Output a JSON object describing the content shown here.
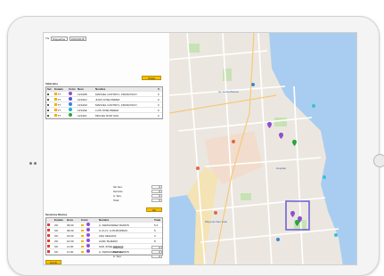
{
  "toolbar": {
    "label": "TG",
    "period": "Dispatcher",
    "date": "19/03/2018"
  },
  "vehicles": {
    "title": "Vehiculos",
    "button": "Todos",
    "columns": [
      "Sel",
      "Estado",
      "Color",
      "Num",
      "Nombre",
      "V"
    ],
    "rows": [
      {
        "sel": "☑",
        "estado": "TT",
        "status": "#f2b200",
        "pin": "#8f4fd1",
        "num": "1234AB",
        "nombre": "MANUEL CASTRO L FRANCISCO",
        "v": "0"
      },
      {
        "sel": "☑",
        "estado": "TT",
        "status": "#f2b200",
        "pin": "#5c4fd6",
        "num": "1234AC",
        "nombre": "JUAN JOSE PEREZ",
        "v": "0"
      },
      {
        "sel": "☑",
        "estado": "TT",
        "status": "#f2b200",
        "pin": "#3d7ee0",
        "num": "1234AD",
        "nombre": "MANUEL CASTRO L FRANCISCO",
        "v": "0"
      },
      {
        "sel": "☑",
        "estado": "TT",
        "status": "#f2b200",
        "pin": "#1fb3c0",
        "num": "1234AE",
        "nombre": "LUIS JOSE PEREZ",
        "v": "0"
      },
      {
        "sel": "☑",
        "estado": "TT",
        "status": "#f2b200",
        "pin": "#27a83c",
        "num": "1234AF",
        "nombre": "MIGUEL RUIZ SAS",
        "v": "0"
      }
    ]
  },
  "summary_top": {
    "rows": [
      {
        "label": "Sin Ser.",
        "value": "0"
      },
      {
        "label": "Servicio",
        "value": "0"
      },
      {
        "label": "A. Ses.",
        "value": "0"
      },
      {
        "label": "Total",
        "value": "5"
      }
    ],
    "button": "Ver"
  },
  "services": {
    "title": "Servicios Diarios",
    "columns": [
      "",
      "Estado",
      "Hora",
      "Color",
      "Nombre",
      "Total"
    ],
    "rows": [
      {
        "status": "#e23a2e",
        "estado": "OK",
        "hora": "09:00",
        "sq": "#f2b200",
        "pin": "#8f4fd1",
        "nombre": "A. FERNANDEZ RAMOS",
        "total": "5.4"
      },
      {
        "status": "#e23a2e",
        "estado": "OK",
        "hora": "09:30",
        "sq": "#f2b200",
        "pin": "#8f4fd1",
        "nombre": "A.V.H.V. LUIS BORRAS",
        "total": "5"
      },
      {
        "status": "#e23a2e",
        "estado": "OK",
        "hora": "10:00",
        "sq": "#f2b200",
        "pin": "#8f4fd1",
        "nombre": "ANA SEGURA",
        "total": "3"
      },
      {
        "status": "#e23a2e",
        "estado": "OK",
        "hora": "10:30",
        "sq": "#f2b200",
        "pin": "#8f4fd1",
        "nombre": "ALBA TEJEIRO",
        "total": "8"
      },
      {
        "status": "#e23a2e",
        "estado": "OK",
        "hora": "11:00",
        "sq": "#f2b200",
        "pin": "#8f4fd1",
        "nombre": "SAN JOSE AMIGOS",
        "total": "4"
      },
      {
        "status": "#e23a2e",
        "estado": "OK",
        "hora": "11:30",
        "sq": "#f2b200",
        "pin": "#8f4fd1",
        "nombre": "A. FERNANDEZ RAMOS",
        "total": "2.8"
      }
    ]
  },
  "summary_bottom": {
    "rows": [
      {
        "label": "Abiertos",
        "value": "0"
      },
      {
        "label": "Pedidos",
        "value": "6"
      },
      {
        "label": "A. Ses.",
        "value": "0"
      }
    ],
    "button": "Cerrar"
  },
  "map_labels": [
    "Playa de San Juan",
    "Av. Costa Blanca",
    "Hospital"
  ],
  "colors": {
    "sea": "#a9cdf0",
    "beach": "#f4e3b5",
    "park": "#c7e2b4",
    "selection": "#6a5ad6",
    "accent_button": "#f5c000"
  }
}
